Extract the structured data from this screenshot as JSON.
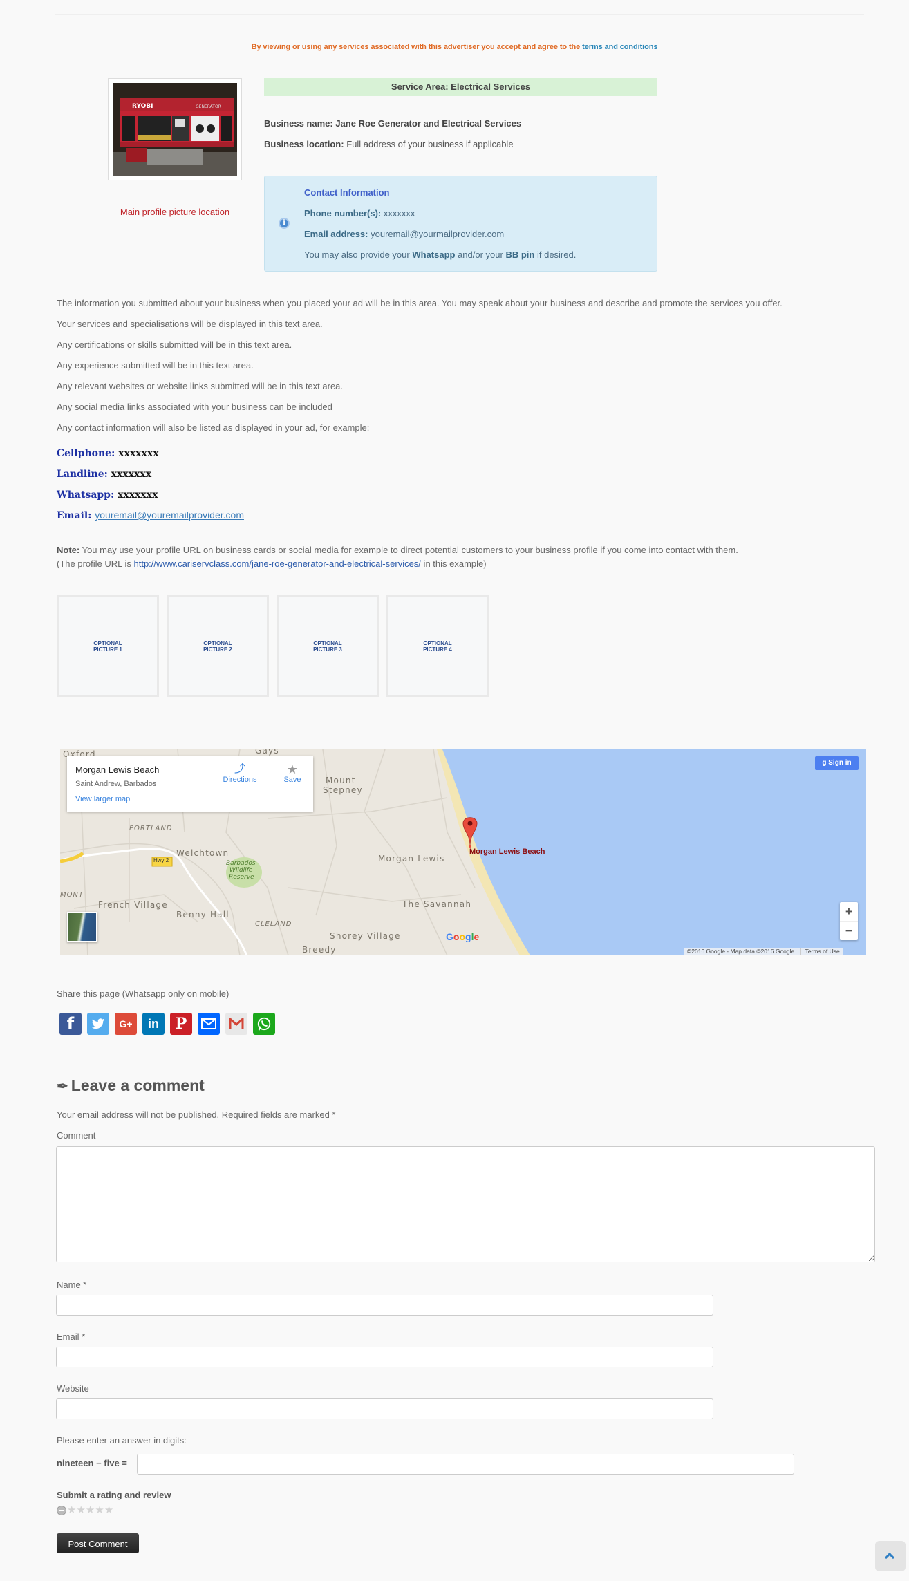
{
  "terms": {
    "text": "By viewing or using any services associated with this advertiser you accept and agree to the ",
    "link": "terms and conditions"
  },
  "profile": {
    "image_alt": "Ryobi generator photo",
    "caption": "Main profile picture location"
  },
  "service_area": "Service Area: Electrical Services",
  "business": {
    "name_label": "Business name:",
    "name_value": "Jane Roe Generator and Electrical Services",
    "location_label": "Business location:",
    "location_value": "Full address of your business if applicable"
  },
  "contact_box": {
    "title": "Contact Information",
    "phone_label": "Phone number(s):",
    "phone_value": "xxxxxxx",
    "email_label": "Email address:",
    "email_value": "youremail@yourmailprovider.com",
    "extra_pre": "You may also provide your ",
    "extra_b1": "Whatsapp",
    "extra_mid": " and/or your ",
    "extra_b2": "BB pin",
    "extra_post": " if desired."
  },
  "description": [
    "The information you submitted about your business when you placed your ad will be in this area. You may speak about your business and describe and promote the services you offer.",
    "Your services and specialisations will be displayed in this text area.",
    "Any certifications or skills submitted will be in this text area.",
    "Any experience submitted will be in this text area.",
    "Any relevant websites or website links submitted will be in this text area.",
    "Any social media links associated with your business can be included",
    "Any contact information will also be listed as displayed in your ad, for example:"
  ],
  "contact_fields": [
    {
      "label": "Cellphone:",
      "value": "xxxxxxx"
    },
    {
      "label": "Landline:",
      "value": "xxxxxxx"
    },
    {
      "label": "Whatsapp:",
      "value": "xxxxxxx"
    },
    {
      "label": "Email:",
      "value": "youremail@youremailprovider.com"
    }
  ],
  "note": {
    "label": "Note:",
    "text": " You may use your profile URL on business cards or social media for example to direct potential customers to your business profile if you come into contact with them.",
    "url_pre": "(The profile URL is ",
    "url": "http://www.cariservclass.com/jane-roe-generator-and-electrical-services/",
    "url_post": " in this example)"
  },
  "optional_pictures": [
    {
      "line1": "OPTIONAL",
      "line2": "PICTURE 1"
    },
    {
      "line1": "OPTIONAL",
      "line2": "PICTURE 2"
    },
    {
      "line1": "OPTIONAL",
      "line2": "PICTURE 3"
    },
    {
      "line1": "OPTIONAL",
      "line2": "PICTURE 4"
    }
  ],
  "map": {
    "place_name": "Morgan Lewis Beach",
    "place_address": "Saint Andrew, Barbados",
    "view_larger": "View larger map",
    "directions": "Directions",
    "save": "Save",
    "sign_in": "Sign in",
    "marker_label": "Morgan Lewis Beach",
    "zoom_in": "+",
    "zoom_out": "−",
    "attribution": "©2016 Google - Map data ©2016 Google",
    "terms": "Terms of Use",
    "logo": "Google",
    "highway": "Hwy 2",
    "labels": [
      "Oxford",
      "Gays",
      "Mount",
      "Stepney",
      "PORTLAND",
      "Welchtown",
      "Barbados",
      "Wildlife",
      "Reserve",
      "Morgan Lewis",
      "MONT",
      "French Village",
      "Benny Hall",
      "CLELAND",
      "The Savannah",
      "Shorey Village",
      "Breedy"
    ],
    "colors": {
      "land": "#ebe7df",
      "water": "#a9c9f5",
      "beach": "#f3e6b4",
      "park": "#c8dfa8",
      "marker": "#e94b3c"
    }
  },
  "share": {
    "label": "Share this page (Whatsapp only on mobile)",
    "buttons": [
      {
        "name": "facebook",
        "glyph": "f",
        "color": "#3b5998"
      },
      {
        "name": "twitter",
        "glyph": "t",
        "color": "#55acee"
      },
      {
        "name": "google-plus",
        "glyph": "G+",
        "color": "#dd4b39"
      },
      {
        "name": "linkedin",
        "glyph": "in",
        "color": "#0077b5"
      },
      {
        "name": "pinterest",
        "glyph": "P",
        "color": "#cb2027"
      },
      {
        "name": "email",
        "glyph": "✉",
        "color": "#0166ff"
      },
      {
        "name": "gmail",
        "glyph": "M",
        "color": "#e8e8e8"
      },
      {
        "name": "whatsapp",
        "glyph": "✆",
        "color": "#1ca81c"
      }
    ]
  },
  "comment_form": {
    "title": "Leave a comment",
    "notice": "Your email address will not be published. Required fields are marked *",
    "comment_label": "Comment",
    "comment_value": "",
    "name_label": "Name *",
    "name_value": "",
    "email_label": "Email *",
    "email_value": "",
    "website_label": "Website",
    "website_value": "",
    "captcha_prompt": "Please enter an answer in digits:",
    "captcha_question": "nineteen − five =",
    "captcha_value": "",
    "rating_title": "Submit a rating and review",
    "rating_value": 0,
    "rating_max": 5,
    "submit_label": "Post Comment"
  }
}
